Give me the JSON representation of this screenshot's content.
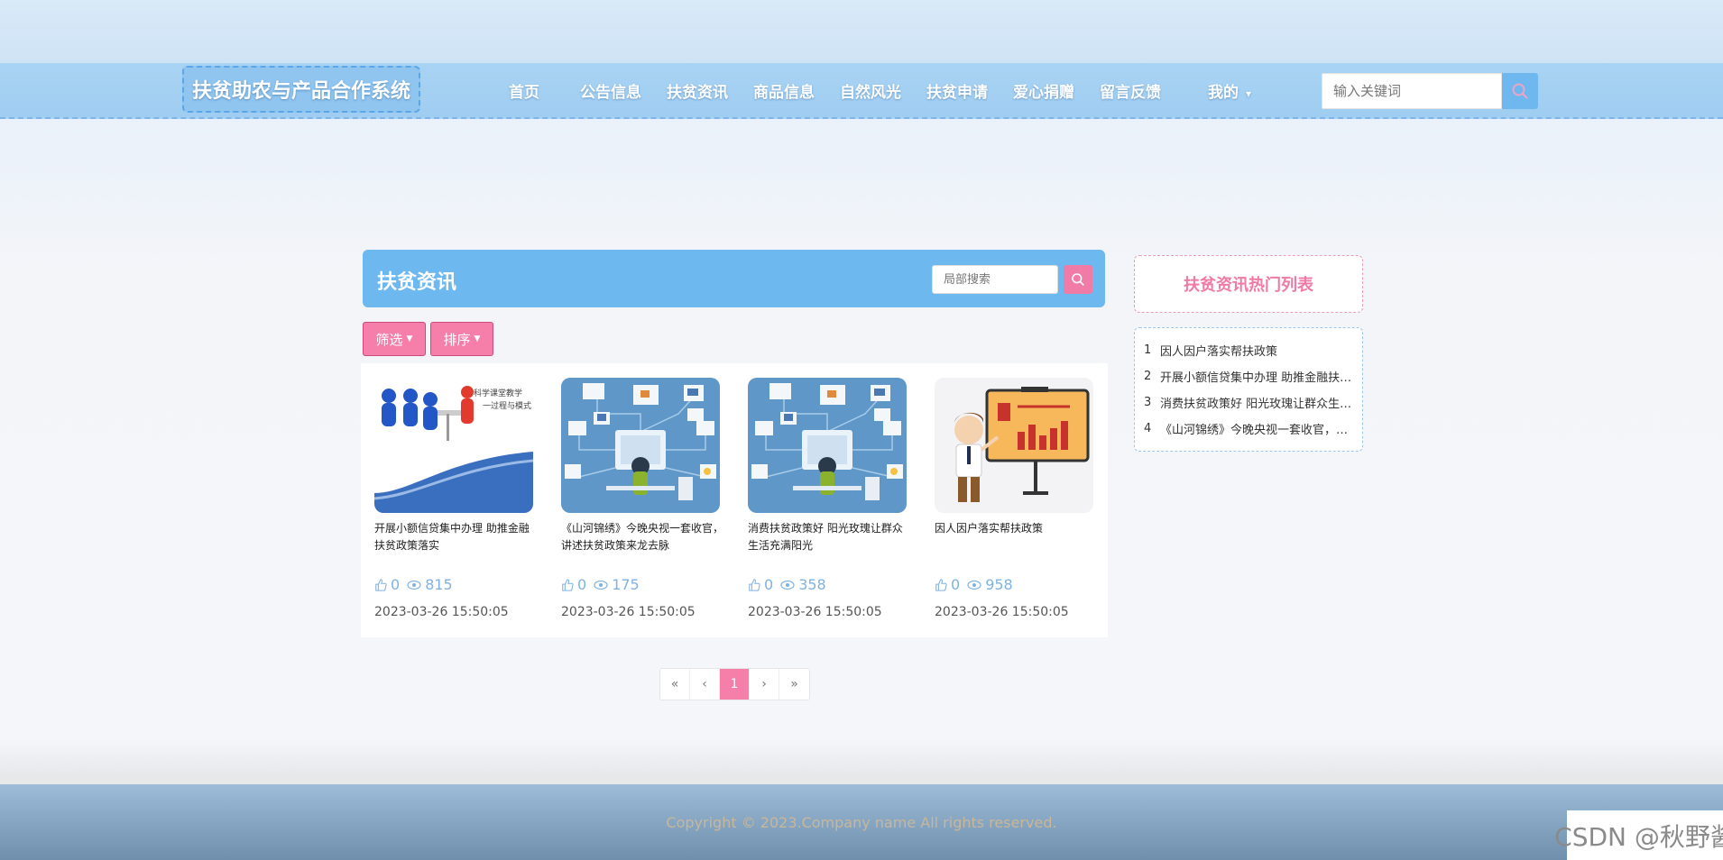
{
  "app": {
    "title": "扶贫助农与产品合作系统"
  },
  "nav": {
    "items": [
      {
        "label": "首页"
      },
      {
        "label": "公告信息"
      },
      {
        "label": "扶贫资讯"
      },
      {
        "label": "商品信息"
      },
      {
        "label": "自然风光"
      },
      {
        "label": "扶贫申请"
      },
      {
        "label": "爱心捐赠"
      },
      {
        "label": "留言反馈"
      },
      {
        "label": "我的"
      }
    ],
    "search_placeholder": "输入关键词"
  },
  "section": {
    "title": "扶贫资讯",
    "search_placeholder": "局部搜索",
    "filter_label": "筛选",
    "sort_label": "排序"
  },
  "cards": [
    {
      "title": "开展小额信贷集中办理 助推金融扶贫政策落实",
      "likes": "0",
      "views": "815",
      "date": "2023-03-26 15:50:05",
      "image": "classroom-teaching-image",
      "image_text": "科学课堂教学\n一过程与模式"
    },
    {
      "title": "《山河锦绣》今晚央视一套收官，讲述扶贫政策来龙去脉",
      "likes": "0",
      "views": "175",
      "date": "2023-03-26 15:50:05",
      "image": "network-computer-image"
    },
    {
      "title": "消费扶贫政策好 阳光玫瑰让群众生活充满阳光",
      "likes": "0",
      "views": "358",
      "date": "2023-03-26 15:50:05",
      "image": "network-computer-image"
    },
    {
      "title": "因人因户落实帮扶政策",
      "likes": "0",
      "views": "958",
      "date": "2023-03-26 15:50:05",
      "image": "presenter-chart-image"
    }
  ],
  "pagination": {
    "first": "«",
    "prev": "‹",
    "current": "1",
    "next": "›",
    "last": "»"
  },
  "hot": {
    "title": "扶贫资讯热门列表",
    "items": [
      {
        "num": "1",
        "text": "因人因户落实帮扶政策"
      },
      {
        "num": "2",
        "text": "开展小额信贷集中办理 助推金融扶贫政策落实"
      },
      {
        "num": "3",
        "text": "消费扶贫政策好 阳光玫瑰让群众生活充满阳光"
      },
      {
        "num": "4",
        "text": "《山河锦绣》今晚央视一套收官，讲述扶贫政策来龙去脉"
      }
    ]
  },
  "footer": {
    "copyright": "Copyright © 2023.Company name All rights reserved."
  },
  "watermark": {
    "text": "CSDN @秋野酱"
  },
  "colors": {
    "accent_blue": "#6db8ef",
    "accent_pink": "#f57fa9",
    "nav_bg": "#a9d3f3"
  }
}
